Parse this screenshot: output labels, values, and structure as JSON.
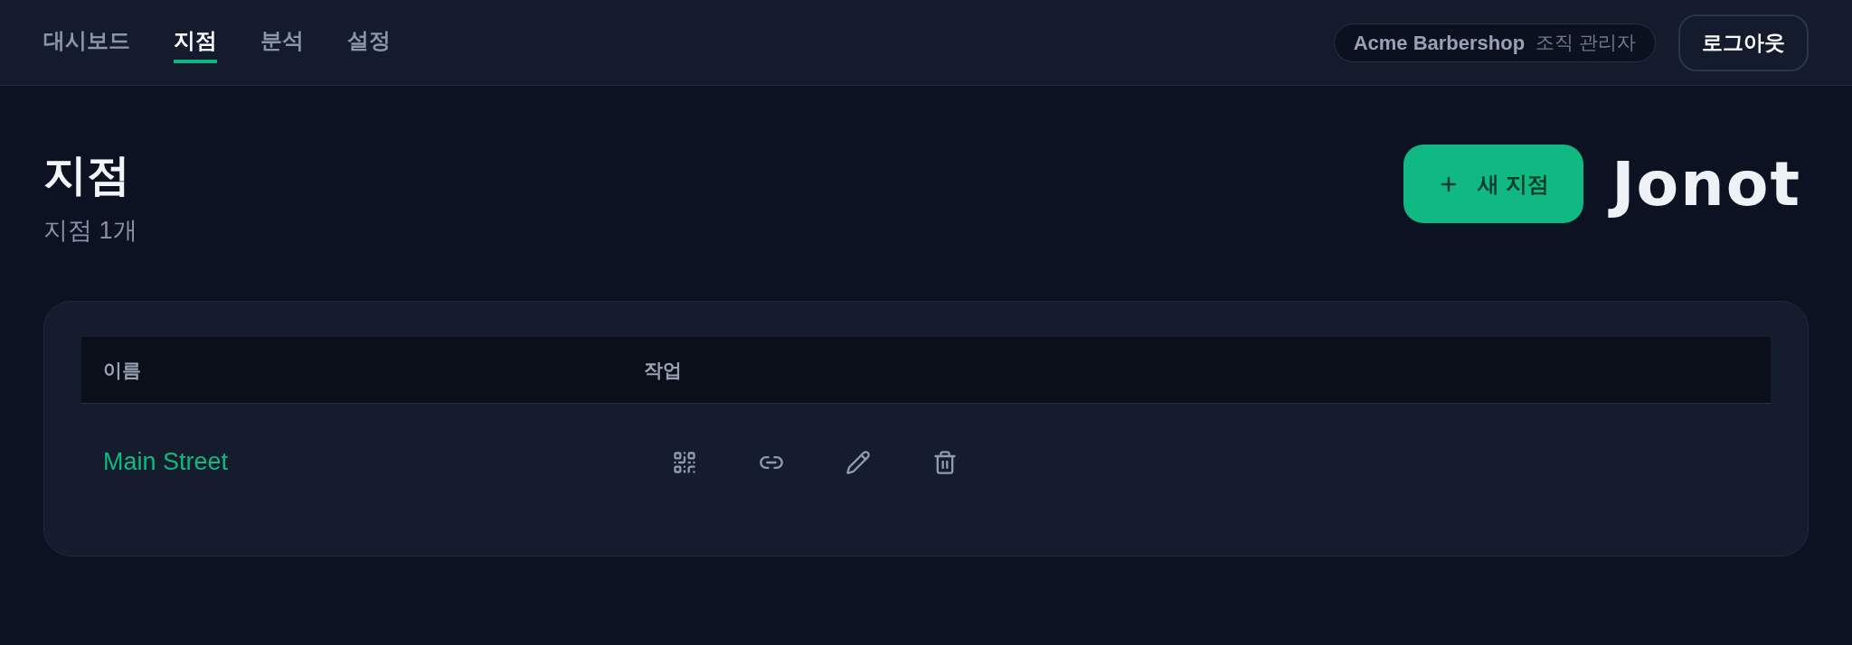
{
  "nav": {
    "tabs": [
      {
        "label": "대시보드",
        "selected": false
      },
      {
        "label": "지점",
        "selected": true
      },
      {
        "label": "분석",
        "selected": false
      },
      {
        "label": "설정",
        "selected": false
      }
    ]
  },
  "account": {
    "organization": "Acme Barbershop",
    "role": "조직 관리자",
    "logout": "로그아웃"
  },
  "page": {
    "title": "지점",
    "subtitle": "지점 1개",
    "new_button": "새 지점",
    "logo": "Jonot"
  },
  "table": {
    "columns": [
      "이름",
      "작업"
    ],
    "rows": [
      {
        "name": "Main Street"
      }
    ]
  }
}
